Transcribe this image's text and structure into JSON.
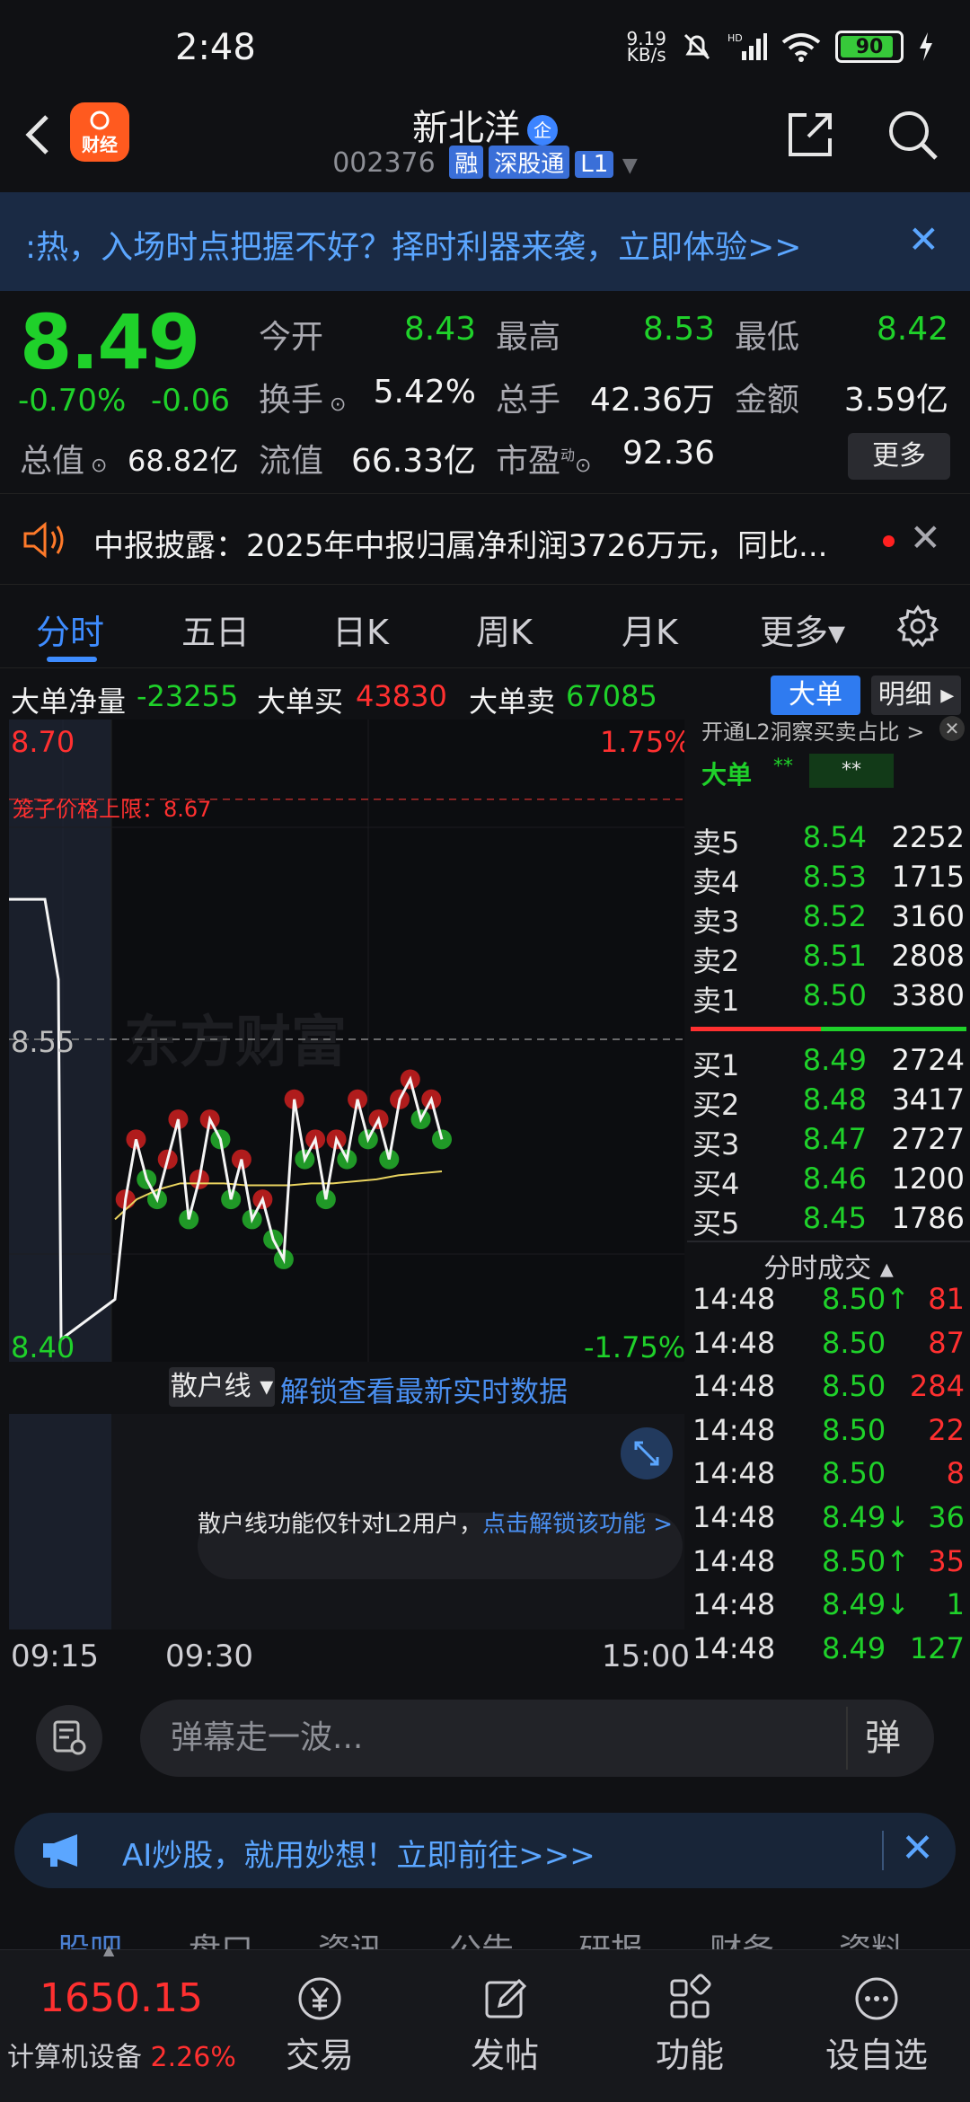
{
  "status": {
    "time": "2:48",
    "net_speed_top": "9.19",
    "net_speed_unit": "KB/s",
    "battery": "90",
    "battery_level": 0.9
  },
  "header": {
    "logo_text": "财经",
    "title": "新北洋",
    "badge": "企",
    "code": "002376",
    "tags": [
      "融",
      "深股通",
      "L1"
    ]
  },
  "banner": {
    "text": ":热，入场时点把握不好？择时利器来袭，立即体验>>",
    "close": "✕"
  },
  "quote": {
    "price": "8.49",
    "change_pct": "-0.70%",
    "change": "-0.06",
    "fields": [
      {
        "label": "今开",
        "value": "8.43",
        "color": "#1fd12a"
      },
      {
        "label": "最高",
        "value": "8.53",
        "color": "#1fd12a"
      },
      {
        "label": "最低",
        "value": "8.42",
        "color": "#1fd12a"
      },
      {
        "label": "换手",
        "value": "5.42%",
        "color": "#f2f2f2"
      },
      {
        "label": "总手",
        "value": "42.36万",
        "color": "#f2f2f2"
      },
      {
        "label": "金额",
        "value": "3.59亿",
        "color": "#f2f2f2"
      },
      {
        "label": "总值",
        "value": "68.82亿",
        "color": "#f2f2f2"
      },
      {
        "label": "流值",
        "value": "66.33亿",
        "color": "#f2f2f2"
      },
      {
        "label": "市盈",
        "value": "92.36",
        "color": "#f2f2f2"
      }
    ],
    "pe_super": "动",
    "more": "更多"
  },
  "notice": {
    "text": "中报披露：2025年中报归属净利润3726万元，同比...",
    "close": "✕"
  },
  "tabs": [
    {
      "label": "分时",
      "active": true
    },
    {
      "label": "五日",
      "active": false
    },
    {
      "label": "日K",
      "active": false
    },
    {
      "label": "周K",
      "active": false
    },
    {
      "label": "月K",
      "active": false
    },
    {
      "label": "更多▾",
      "active": false
    }
  ],
  "bigorder": {
    "net_label": "大单净量",
    "net_value": "-23255",
    "buy_label": "大单买",
    "buy_value": "43830",
    "sell_label": "大单卖",
    "sell_value": "67085",
    "btn_big": "大单",
    "btn_detail": "明细 ▸"
  },
  "chart_overlay": {
    "price_top": "8.70",
    "pct_top": "1.75%",
    "price_mid": "8.55",
    "price_bottom": "8.40",
    "pct_bottom": "-1.75%",
    "limit_label": "笼子价格上限：8.67",
    "watermark": "东方财富",
    "retail_btn": "散户线 ▾",
    "unlock": "解锁查看最新实时数据",
    "retail_msg": "散户线功能仅针对L2用户，",
    "retail_link": "点击解锁该功能 >",
    "times": [
      "09:15",
      "09:30",
      "15:00"
    ],
    "l2_hint": "开通L2洞察买卖占比 >",
    "l2_big": "大单",
    "l2_stars": "**"
  },
  "chart_data": {
    "type": "line",
    "title": "",
    "xlabel": "",
    "ylabel": "",
    "ylim": [
      8.4,
      8.7
    ],
    "reference": 8.55,
    "limit_line": 8.67,
    "x": [
      "09:15",
      "09:30",
      "15:00"
    ],
    "series": [
      {
        "name": "",
        "values": [
          8.62,
          8.62,
          8.58,
          8.4,
          8.42,
          8.47,
          8.5,
          8.48,
          8.47,
          8.49,
          8.51,
          8.46,
          8.48,
          8.51,
          8.5,
          8.47,
          8.49,
          8.46,
          8.47,
          8.45,
          8.44,
          8.52,
          8.49,
          8.5,
          8.47,
          8.5,
          8.49,
          8.52,
          8.5,
          8.51,
          8.49,
          8.52,
          8.53,
          8.51,
          8.52,
          8.5
        ]
      },
      {
        "name": "",
        "values": [
          8.46,
          8.47,
          8.475,
          8.478,
          8.478,
          8.478,
          8.477,
          8.477,
          8.477,
          8.478,
          8.478,
          8.479,
          8.48,
          8.482,
          8.483,
          8.484
        ]
      }
    ]
  },
  "orderbook": {
    "asks": [
      {
        "label": "卖5",
        "price": "8.54",
        "vol": "2252"
      },
      {
        "label": "卖4",
        "price": "8.53",
        "vol": "1715"
      },
      {
        "label": "卖3",
        "price": "8.52",
        "vol": "3160"
      },
      {
        "label": "卖2",
        "price": "8.51",
        "vol": "2808"
      },
      {
        "label": "卖1",
        "price": "8.50",
        "vol": "3380"
      }
    ],
    "bids": [
      {
        "label": "买1",
        "price": "8.49",
        "vol": "2724"
      },
      {
        "label": "买2",
        "price": "8.48",
        "vol": "3417"
      },
      {
        "label": "买3",
        "price": "8.47",
        "vol": "2727"
      },
      {
        "label": "买4",
        "price": "8.46",
        "vol": "1200"
      },
      {
        "label": "买5",
        "price": "8.45",
        "vol": "1786"
      }
    ]
  },
  "trades": {
    "title": "分时成交 ▴",
    "rows": [
      {
        "time": "14:48",
        "price": "8.50↑",
        "vol": "81",
        "pc": "#1fd12a",
        "vc": "#ff3030"
      },
      {
        "time": "14:48",
        "price": "8.50",
        "vol": "87",
        "pc": "#1fd12a",
        "vc": "#ff3030"
      },
      {
        "time": "14:48",
        "price": "8.50",
        "vol": "284",
        "pc": "#1fd12a",
        "vc": "#ff3030"
      },
      {
        "time": "14:48",
        "price": "8.50",
        "vol": "22",
        "pc": "#1fd12a",
        "vc": "#ff3030"
      },
      {
        "time": "14:48",
        "price": "8.50",
        "vol": "8",
        "pc": "#1fd12a",
        "vc": "#ff3030"
      },
      {
        "time": "14:48",
        "price": "8.49↓",
        "vol": "36",
        "pc": "#1fd12a",
        "vc": "#1fd12a"
      },
      {
        "time": "14:48",
        "price": "8.50↑",
        "vol": "35",
        "pc": "#1fd12a",
        "vc": "#ff3030"
      },
      {
        "time": "14:48",
        "price": "8.49↓",
        "vol": "1",
        "pc": "#1fd12a",
        "vc": "#1fd12a"
      },
      {
        "time": "14:48",
        "price": "8.49",
        "vol": "127",
        "pc": "#1fd12a",
        "vc": "#1fd12a"
      }
    ]
  },
  "comment": {
    "placeholder": "弹幕走一波...",
    "dan": "弹"
  },
  "ai": {
    "text": "AI炒股，就用妙想！立即前往>>>",
    "close": "✕"
  },
  "subtabs": [
    "股吧",
    "盘口",
    "资讯",
    "公告",
    "研报",
    "财务",
    "资料"
  ],
  "bottom": {
    "index_price": "1650.15",
    "index_name": "计算机设备",
    "index_pct": "2.26%",
    "items": [
      "交易",
      "发帖",
      "功能",
      "设自选"
    ]
  }
}
